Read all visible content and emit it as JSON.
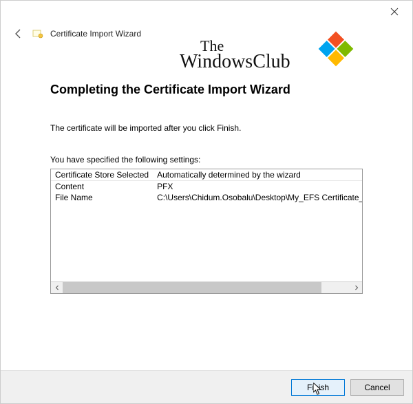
{
  "window": {
    "title": "Certificate Import Wizard"
  },
  "watermark": {
    "line1": "The",
    "line2": "WindowsClub"
  },
  "page": {
    "heading": "Completing the Certificate Import Wizard",
    "instruction": "The certificate will be imported after you click Finish.",
    "settings_intro": "You have specified the following settings:",
    "settings": [
      {
        "key": "Certificate Store Selected",
        "value": "Automatically determined by the wizard"
      },
      {
        "key": "Content",
        "value": "PFX"
      },
      {
        "key": "File Name",
        "value": "C:\\Users\\Chidum.Osobalu\\Desktop\\My_EFS Certificate_and_I"
      }
    ]
  },
  "buttons": {
    "finish": "Finish",
    "cancel": "Cancel"
  }
}
